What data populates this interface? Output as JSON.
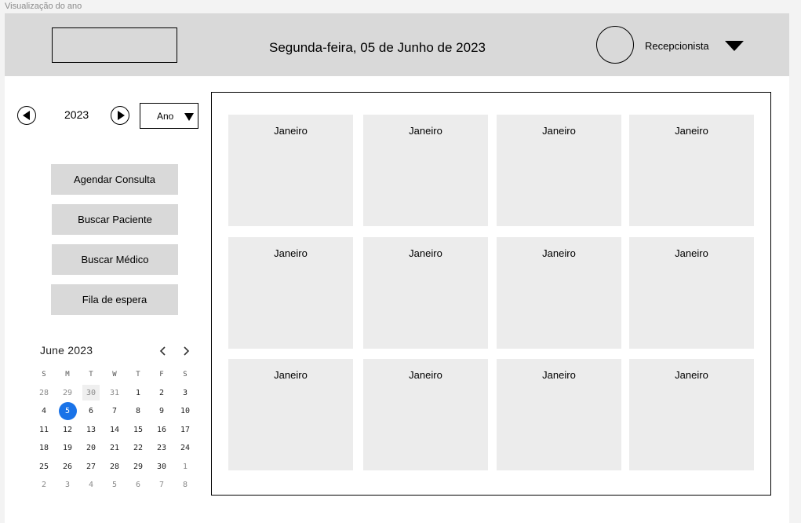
{
  "frame_label": "Visualização do ano",
  "header": {
    "date": "Segunda-feira, 05 de Junho de 2023",
    "user_role": "Recepcionista"
  },
  "year_nav": {
    "year": "2023",
    "view_option": "Ano"
  },
  "sidebar": {
    "buttons": [
      "Agendar Consulta",
      "Buscar Paciente",
      "Buscar Médico",
      "Fila de espera"
    ]
  },
  "mini_calendar": {
    "title": "June 2023",
    "weekdays": [
      "S",
      "M",
      "T",
      "W",
      "T",
      "F",
      "S"
    ],
    "weeks": [
      [
        "28",
        "29",
        "30",
        "31",
        "1",
        "2",
        "3"
      ],
      [
        "4",
        "5",
        "6",
        "7",
        "8",
        "9",
        "10"
      ],
      [
        "11",
        "12",
        "13",
        "14",
        "15",
        "16",
        "17"
      ],
      [
        "18",
        "19",
        "20",
        "21",
        "22",
        "23",
        "24"
      ],
      [
        "25",
        "26",
        "27",
        "28",
        "29",
        "30",
        "1"
      ],
      [
        "2",
        "3",
        "4",
        "5",
        "6",
        "7",
        "8"
      ]
    ],
    "selected_day": "5",
    "accent_color": "#1a73e8"
  },
  "year_grid": {
    "months": [
      "Janeiro",
      "Janeiro",
      "Janeiro",
      "Janeiro",
      "Janeiro",
      "Janeiro",
      "Janeiro",
      "Janeiro",
      "Janeiro",
      "Janeiro",
      "Janeiro",
      "Janeiro"
    ]
  }
}
